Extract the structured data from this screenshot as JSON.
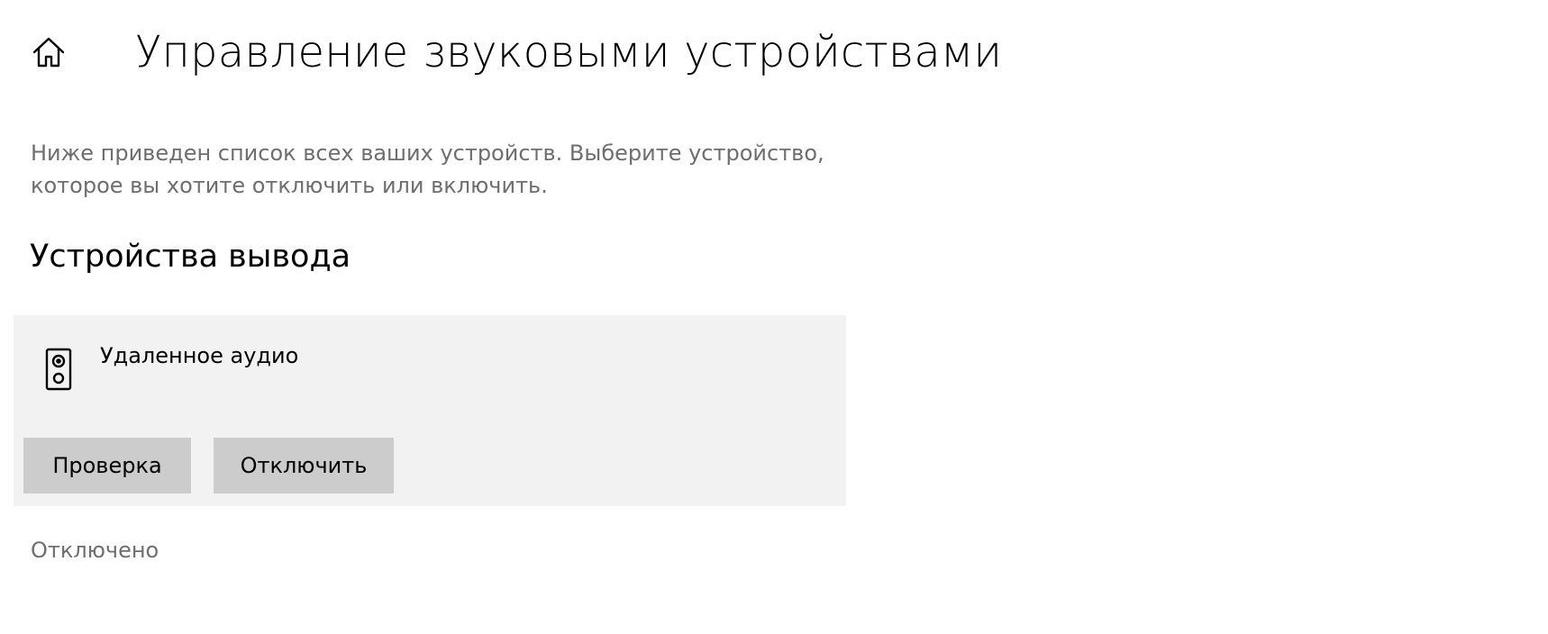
{
  "header": {
    "title": "Управление звуковыми устройствами",
    "home_icon": "home-icon"
  },
  "description": {
    "line1": "Ниже приведен список всех ваших устройств. Выберите устройство,",
    "line2": "которое вы хотите отключить или включить."
  },
  "output_section": {
    "title": "Устройства вывода",
    "devices": [
      {
        "icon": "speaker-icon",
        "name": "Удаленное аудио",
        "test_label": "Проверка",
        "disable_label": "Отключить"
      }
    ]
  },
  "disabled_section": {
    "label": "Отключено"
  },
  "colors": {
    "card_background": "#f2f2f2",
    "button_background": "#cccccc",
    "secondary_text": "#6e6e6e"
  }
}
